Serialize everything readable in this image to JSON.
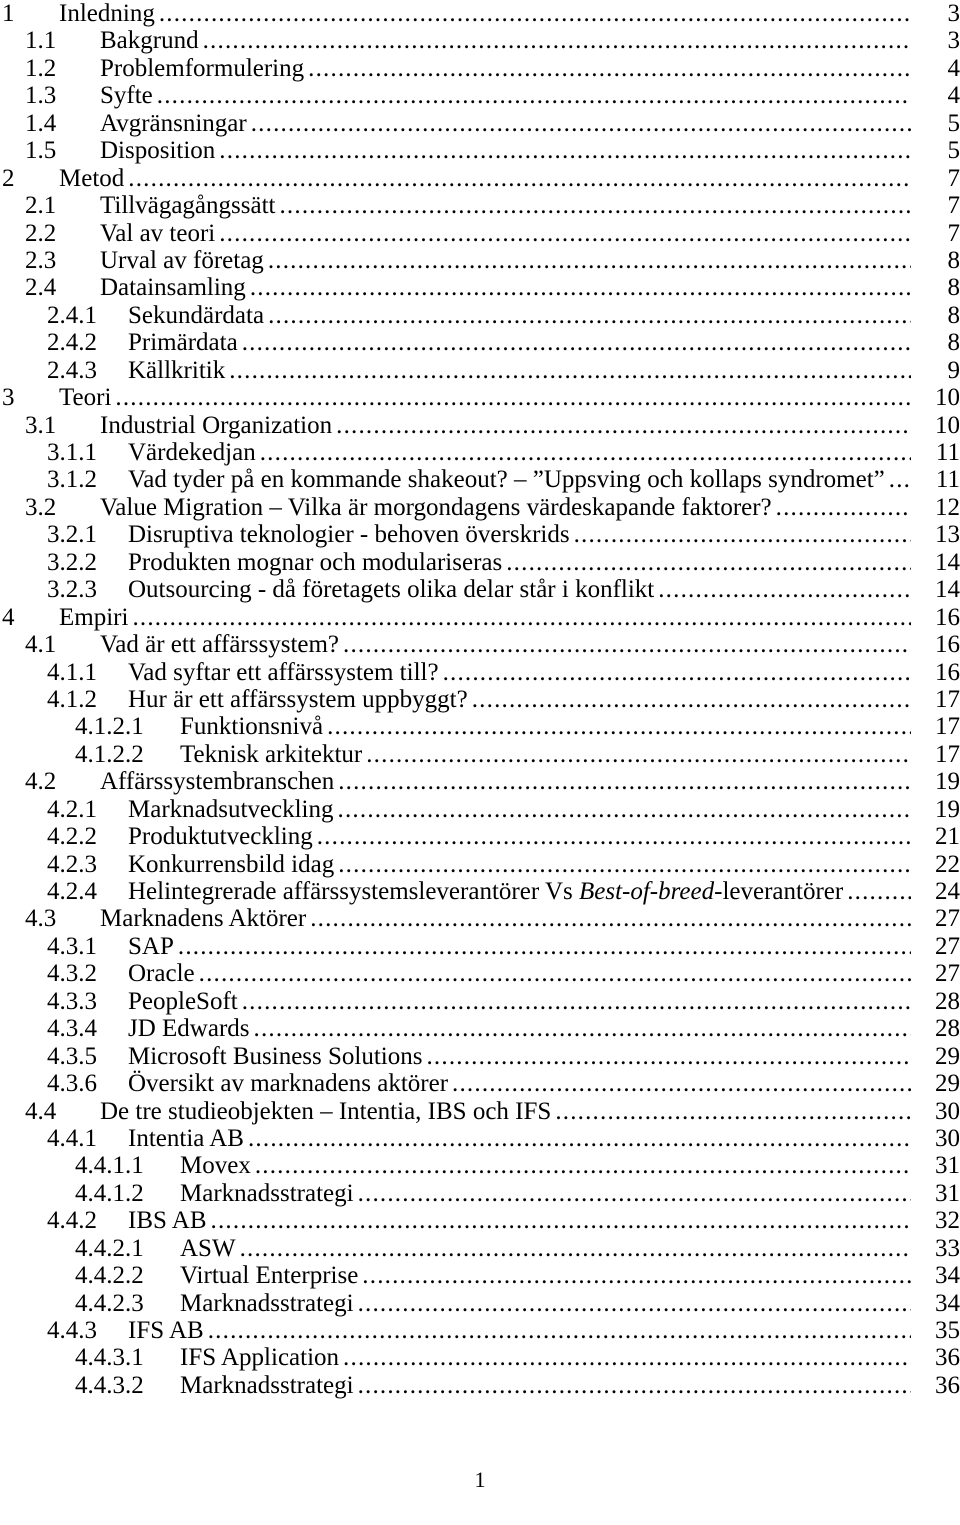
{
  "document": {
    "footer_page_number": "1"
  },
  "toc": {
    "entries": [
      {
        "level": 1,
        "number": "1",
        "title": "Inledning",
        "page": "3"
      },
      {
        "level": 2,
        "number": "1.1",
        "title": "Bakgrund",
        "page": "3"
      },
      {
        "level": 2,
        "number": "1.2",
        "title": "Problemformulering",
        "page": "4"
      },
      {
        "level": 2,
        "number": "1.3",
        "title": "Syfte",
        "page": "4"
      },
      {
        "level": 2,
        "number": "1.4",
        "title": "Avgränsningar",
        "page": "5"
      },
      {
        "level": 2,
        "number": "1.5",
        "title": "Disposition",
        "page": "5"
      },
      {
        "level": 1,
        "number": "2",
        "title": "Metod",
        "page": "7"
      },
      {
        "level": 2,
        "number": "2.1",
        "title": "Tillvägagångssätt",
        "page": "7"
      },
      {
        "level": 2,
        "number": "2.2",
        "title": "Val av teori",
        "page": "7"
      },
      {
        "level": 2,
        "number": "2.3",
        "title": "Urval av företag",
        "page": "8"
      },
      {
        "level": 2,
        "number": "2.4",
        "title": "Datainsamling",
        "page": "8"
      },
      {
        "level": 3,
        "number": "2.4.1",
        "title": "Sekundärdata",
        "page": "8"
      },
      {
        "level": 3,
        "number": "2.4.2",
        "title": "Primärdata",
        "page": "8"
      },
      {
        "level": 3,
        "number": "2.4.3",
        "title": "Källkritik",
        "page": "9"
      },
      {
        "level": 1,
        "number": "3",
        "title": "Teori",
        "page": "10"
      },
      {
        "level": 2,
        "number": "3.1",
        "title": "Industrial Organization",
        "page": "10"
      },
      {
        "level": 3,
        "number": "3.1.1",
        "title": "Värdekedjan",
        "page": "11"
      },
      {
        "level": 3,
        "number": "3.1.2",
        "title": "Vad tyder på en kommande shakeout? – ”Uppsving och kollaps syndromet”",
        "page": "11"
      },
      {
        "level": 2,
        "number": "3.2",
        "title": "Value Migration – Vilka är morgondagens värdeskapande faktorer?",
        "page": "12"
      },
      {
        "level": 3,
        "number": "3.2.1",
        "title": "Disruptiva teknologier - behoven överskrids",
        "page": "13"
      },
      {
        "level": 3,
        "number": "3.2.2",
        "title": "Produkten mognar och modulariseras",
        "page": "14"
      },
      {
        "level": 3,
        "number": "3.2.3",
        "title": "Outsourcing - då företagets olika delar står i konflikt",
        "page": "14"
      },
      {
        "level": 1,
        "number": "4",
        "title": "Empiri",
        "page": "16"
      },
      {
        "level": 2,
        "number": "4.1",
        "title": "Vad är ett affärssystem?",
        "page": "16"
      },
      {
        "level": 3,
        "number": "4.1.1",
        "title": "Vad syftar ett affärssystem till?",
        "page": "16"
      },
      {
        "level": 3,
        "number": "4.1.2",
        "title": "Hur är ett affärssystem uppbyggt?",
        "page": "17"
      },
      {
        "level": 4,
        "number": "4.1.2.1",
        "title": "Funktionsnivå",
        "page": "17"
      },
      {
        "level": 4,
        "number": "4.1.2.2",
        "title": "Teknisk arkitektur",
        "page": "17"
      },
      {
        "level": 2,
        "number": "4.2",
        "title": "Affärssystembranschen",
        "page": "19"
      },
      {
        "level": 3,
        "number": "4.2.1",
        "title": "Marknadsutveckling",
        "page": "19"
      },
      {
        "level": 3,
        "number": "4.2.2",
        "title": "Produktutveckling",
        "page": "21"
      },
      {
        "level": 3,
        "number": "4.2.3",
        "title": "Konkurrensbild idag",
        "page": "22"
      },
      {
        "level": 3,
        "number": "4.2.4",
        "title": "Helintegrerade affärssystemsleverantörer Vs Best-of-breed-leverantörer",
        "title_html": "Helintegrerade affärssystemsleverantörer Vs <em class=\"bob\">Best-of-breed</em>-leverantörer",
        "page": "24"
      },
      {
        "level": 2,
        "number": "4.3",
        "title": "Marknadens Aktörer",
        "page": "27"
      },
      {
        "level": 3,
        "number": "4.3.1",
        "title": "SAP",
        "page": "27"
      },
      {
        "level": 3,
        "number": "4.3.2",
        "title": "Oracle",
        "page": "27"
      },
      {
        "level": 3,
        "number": "4.3.3",
        "title": "PeopleSoft",
        "page": "28"
      },
      {
        "level": 3,
        "number": "4.3.4",
        "title": "JD Edwards",
        "page": "28"
      },
      {
        "level": 3,
        "number": "4.3.5",
        "title": "Microsoft Business Solutions",
        "page": "29"
      },
      {
        "level": 3,
        "number": "4.3.6",
        "title": "Översikt av marknadens aktörer",
        "page": "29"
      },
      {
        "level": 2,
        "number": "4.4",
        "title": "De tre studieobjekten – Intentia, IBS och IFS",
        "page": "30"
      },
      {
        "level": 3,
        "number": "4.4.1",
        "title": "Intentia AB",
        "page": "30"
      },
      {
        "level": 4,
        "number": "4.4.1.1",
        "title": "Movex",
        "page": "31"
      },
      {
        "level": 4,
        "number": "4.4.1.2",
        "title": "Marknadsstrategi",
        "page": "31"
      },
      {
        "level": 3,
        "number": "4.4.2",
        "title": "IBS AB",
        "page": "32"
      },
      {
        "level": 4,
        "number": "4.4.2.1",
        "title": "ASW",
        "page": "33"
      },
      {
        "level": 4,
        "number": "4.4.2.2",
        "title": "Virtual Enterprise",
        "page": "34"
      },
      {
        "level": 4,
        "number": "4.4.2.3",
        "title": "Marknadsstrategi",
        "page": "34"
      },
      {
        "level": 3,
        "number": "4.4.3",
        "title": "IFS AB",
        "page": "35"
      },
      {
        "level": 4,
        "number": "4.4.3.1",
        "title": "IFS Application",
        "page": "36"
      },
      {
        "level": 4,
        "number": "4.4.3.2",
        "title": "Marknadsstrategi",
        "page": "36"
      }
    ]
  }
}
